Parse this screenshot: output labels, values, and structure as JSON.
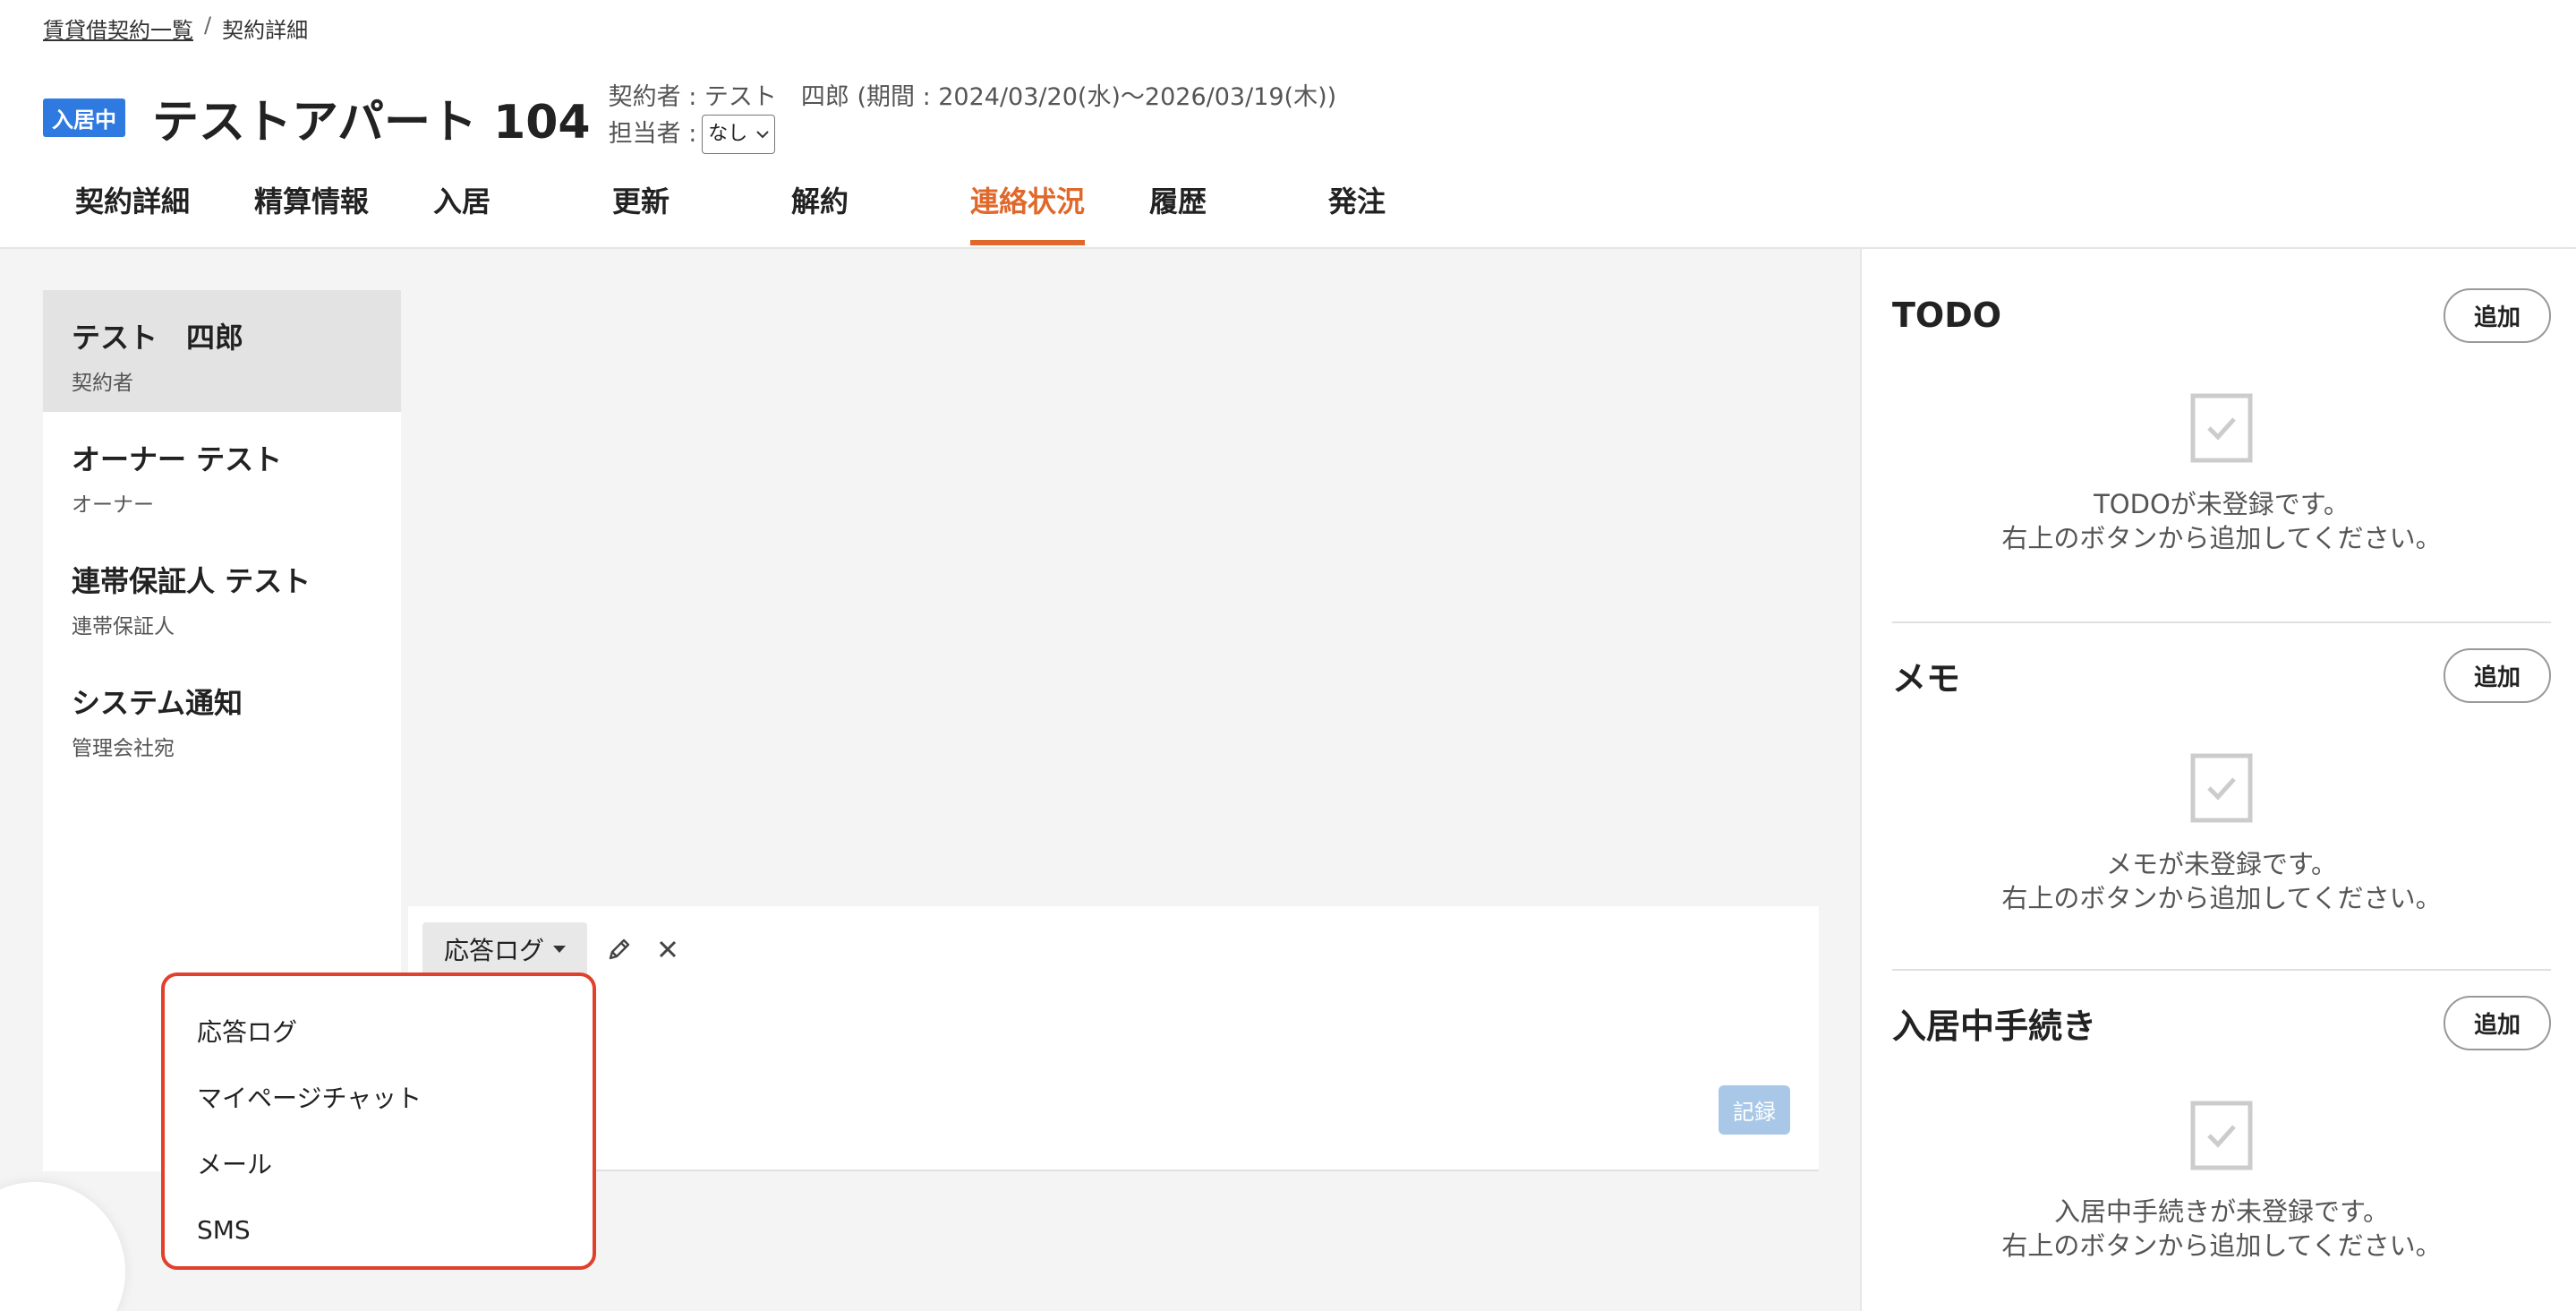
{
  "breadcrumb": {
    "parent": "賃貸借契約一覧",
    "separator": "/",
    "current": "契約詳細"
  },
  "header": {
    "status": "入居中",
    "title": "テストアパート 104",
    "contract_info": "契約者 : テスト　四郎 (期間 : 2024/03/20(水)〜2026/03/19(木))",
    "assignee_label": "担当者 :",
    "assignee_value": "なし"
  },
  "tabs": [
    {
      "label": "契約詳細"
    },
    {
      "label": "精算情報"
    },
    {
      "label": "入居"
    },
    {
      "label": "更新"
    },
    {
      "label": "解約"
    },
    {
      "label": "連絡状況",
      "active": true
    },
    {
      "label": "履歴"
    },
    {
      "label": "発注"
    }
  ],
  "contacts": [
    {
      "name": "テスト　四郎",
      "role": "契約者",
      "selected": true
    },
    {
      "name": "オーナー テスト",
      "role": "オーナー"
    },
    {
      "name": "連帯保証人 テスト",
      "role": "連帯保証人"
    },
    {
      "name": "システム通知",
      "role": "管理会社宛"
    }
  ],
  "composer": {
    "type_selected": "応答ログ",
    "record_label": "記録",
    "menu_items": [
      "応答ログ",
      "マイページチャット",
      "メール",
      "SMS"
    ]
  },
  "sidebar": {
    "add_label": "追加",
    "sections": [
      {
        "title": "TODO",
        "empty_line1": "TODOが未登録です。",
        "empty_line2": "右上のボタンから追加してください。"
      },
      {
        "title": "メモ",
        "empty_line1": "メモが未登録です。",
        "empty_line2": "右上のボタンから追加してください。"
      },
      {
        "title": "入居中手続き",
        "empty_line1": "入居中手続きが未登録です。",
        "empty_line2": "右上のボタンから追加してください。"
      }
    ]
  },
  "colors": {
    "accent": "#e0682a",
    "badge": "#2f7ae0",
    "menu_border": "#e0402c",
    "record_button": "#a9c8e8"
  },
  "icons": {
    "edit": "pencil-icon",
    "close": "close-icon",
    "dropdown": "caret-down-icon",
    "empty": "checkbox-icon"
  }
}
